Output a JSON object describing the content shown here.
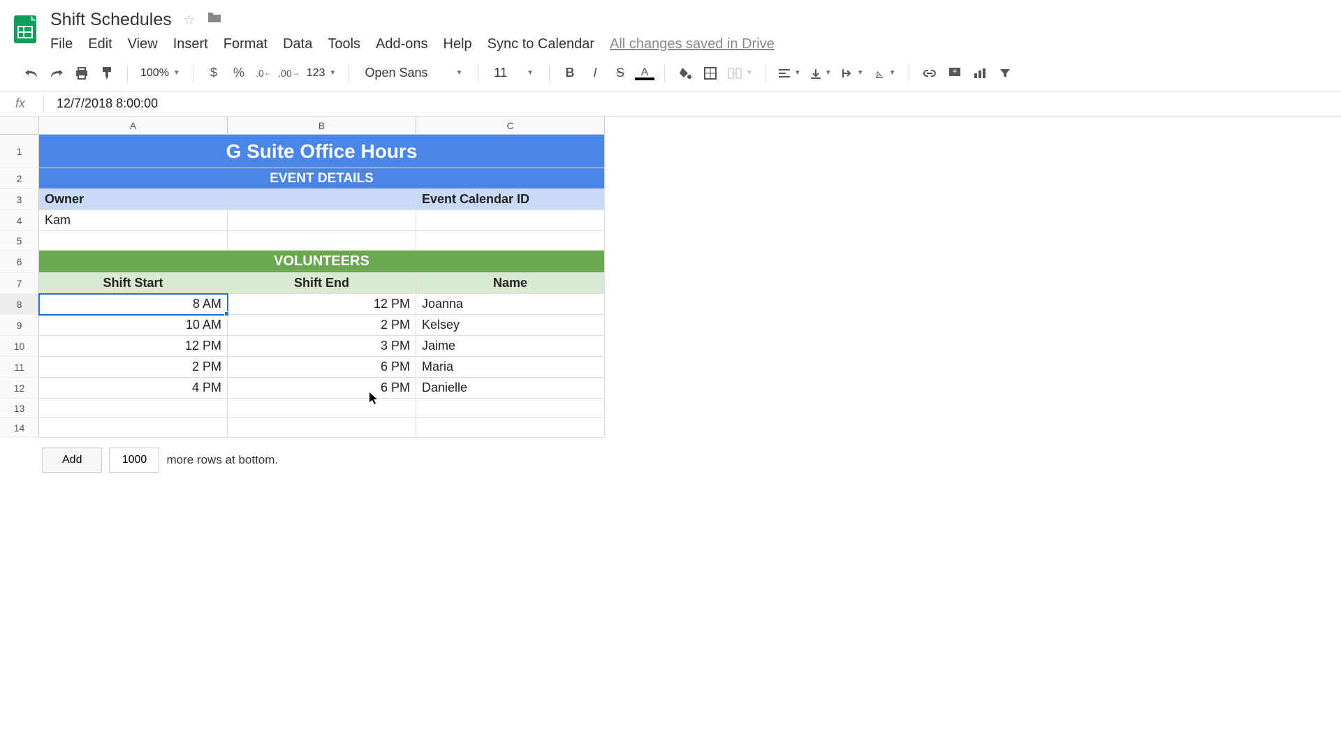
{
  "doc_title": "Shift Schedules",
  "menu": [
    "File",
    "Edit",
    "View",
    "Insert",
    "Format",
    "Data",
    "Tools",
    "Add-ons",
    "Help",
    "Sync to Calendar"
  ],
  "saved_status": "All changes saved in Drive",
  "toolbar": {
    "zoom": "100%",
    "font": "Open Sans",
    "font_size": "11",
    "format_123": "123"
  },
  "formula_bar": "12/7/2018 8:00:00",
  "columns": [
    "A",
    "B",
    "C"
  ],
  "rows": [
    "1",
    "2",
    "3",
    "4",
    "5",
    "6",
    "7",
    "8",
    "9",
    "10",
    "11",
    "12",
    "13",
    "14"
  ],
  "sheet": {
    "title": "G Suite Office Hours",
    "event_details_header": "EVENT DETAILS",
    "owner_label": "Owner",
    "event_cal_label": "Event Calendar ID",
    "owner_value": "Kam",
    "volunteers_header": "VOLUNTEERS",
    "shift_start_label": "Shift Start",
    "shift_end_label": "Shift End",
    "name_label": "Name",
    "shifts": [
      {
        "start": "8 AM",
        "end": "12 PM",
        "name": "Joanna"
      },
      {
        "start": "10 AM",
        "end": "2 PM",
        "name": "Kelsey"
      },
      {
        "start": "12 PM",
        "end": "3 PM",
        "name": "Jaime"
      },
      {
        "start": "2 PM",
        "end": "6 PM",
        "name": "Maria"
      },
      {
        "start": "4 PM",
        "end": "6 PM",
        "name": "Danielle"
      }
    ]
  },
  "footer": {
    "add_label": "Add",
    "row_count": "1000",
    "more_rows": "more rows at bottom."
  }
}
